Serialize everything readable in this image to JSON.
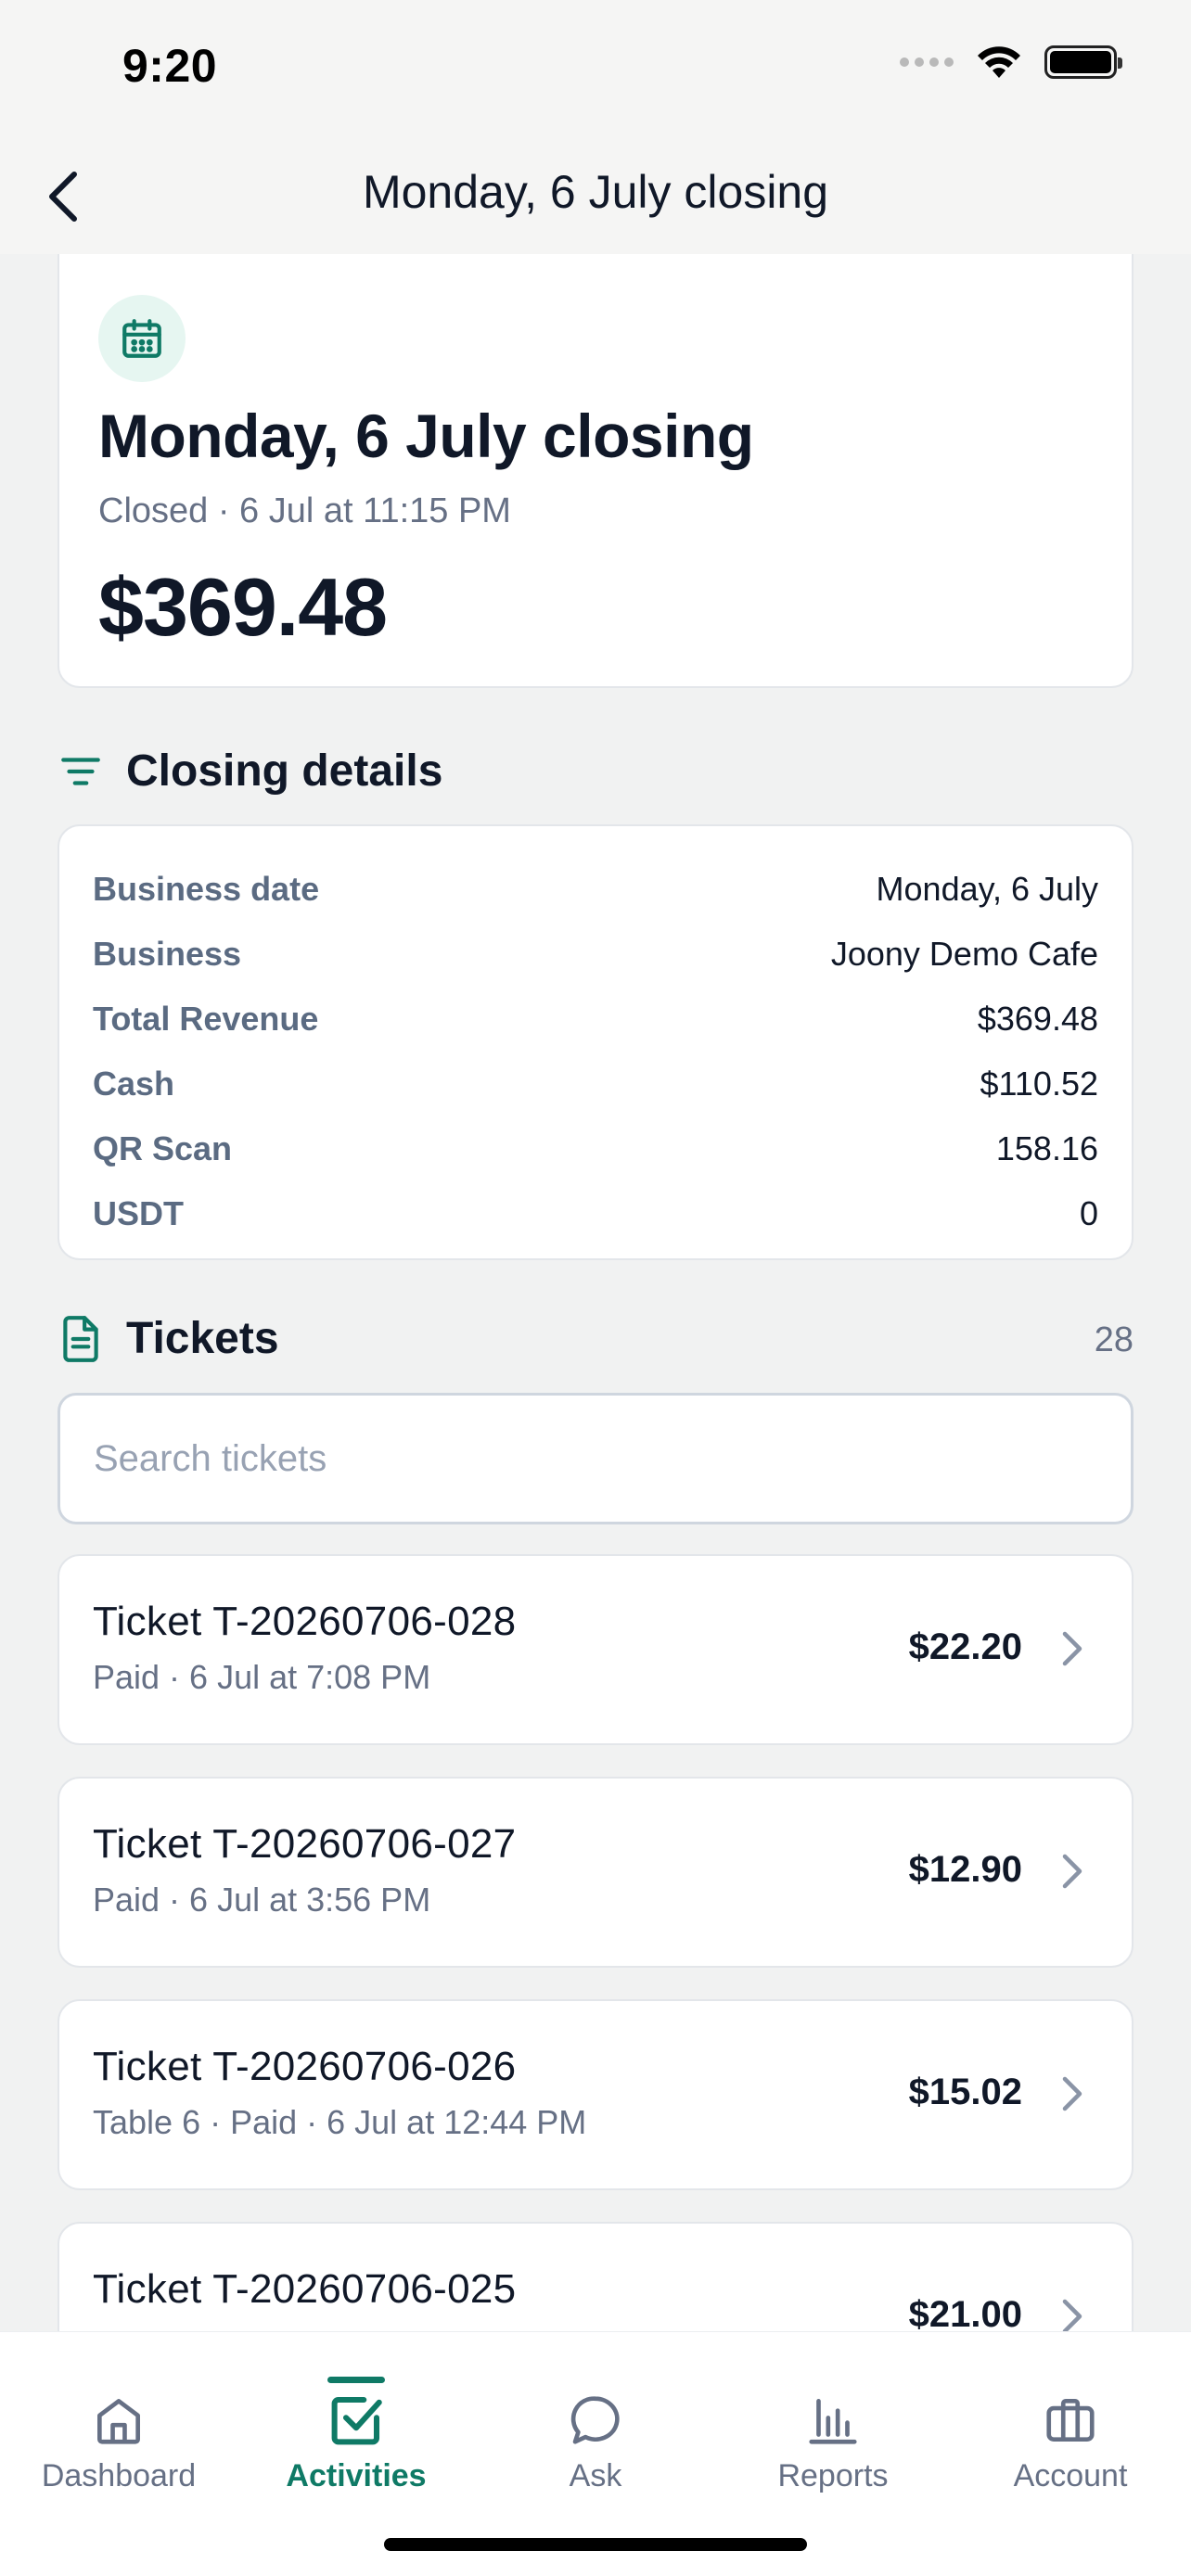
{
  "status_bar": {
    "time": "9:20"
  },
  "nav": {
    "title": "Monday, 6 July closing"
  },
  "summary": {
    "title": "Monday, 6 July closing",
    "subtitle": "Closed · 6 Jul at 11:15 PM",
    "amount": "$369.48"
  },
  "details": {
    "section_title": "Closing details",
    "rows": [
      {
        "label": "Business date",
        "value": "Monday, 6 July"
      },
      {
        "label": "Business",
        "value": "Joony Demo Cafe"
      },
      {
        "label": "Total Revenue",
        "value": "$369.48"
      },
      {
        "label": "Cash",
        "value": "$110.52"
      },
      {
        "label": "QR Scan",
        "value": "158.16"
      },
      {
        "label": "USDT",
        "value": "0"
      }
    ]
  },
  "tickets": {
    "section_title": "Tickets",
    "count": "28",
    "search_placeholder": "Search tickets",
    "items": [
      {
        "title": "Ticket T-20260706-028",
        "subtitle": "Paid · 6 Jul at 7:08 PM",
        "amount": "$22.20"
      },
      {
        "title": "Ticket T-20260706-027",
        "subtitle": "Paid · 6 Jul at 3:56 PM",
        "amount": "$12.90"
      },
      {
        "title": "Ticket T-20260706-026",
        "subtitle": "Table 6 · Paid · 6 Jul at 12:44 PM",
        "amount": "$15.02"
      },
      {
        "title": "Ticket T-20260706-025",
        "subtitle": "",
        "amount": "$21.00"
      }
    ]
  },
  "tab_bar": {
    "tabs": [
      {
        "label": "Dashboard",
        "icon": "home-icon"
      },
      {
        "label": "Activities",
        "icon": "checkbox-icon",
        "active": true
      },
      {
        "label": "Ask",
        "icon": "chat-bubble-icon"
      },
      {
        "label": "Reports",
        "icon": "bar-chart-icon"
      },
      {
        "label": "Account",
        "icon": "briefcase-icon"
      }
    ]
  },
  "colors": {
    "accent": "#0f7a66",
    "accent_light": "#e6f6f1",
    "text": "#101828",
    "muted": "#667085"
  }
}
